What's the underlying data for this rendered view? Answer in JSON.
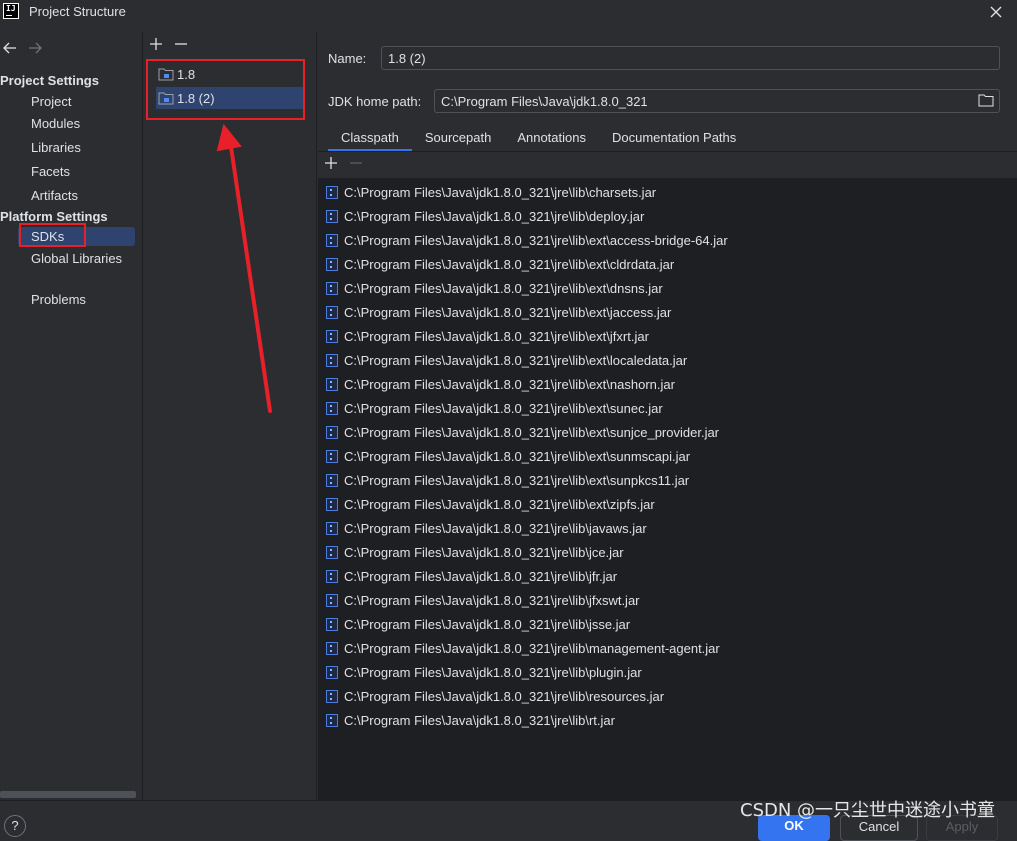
{
  "window": {
    "title": "Project Structure",
    "app_icon_text": "IJ"
  },
  "nav": {
    "sections": [
      {
        "title": "Project Settings",
        "items": [
          "Project",
          "Modules",
          "Libraries",
          "Facets",
          "Artifacts"
        ]
      },
      {
        "title": "Platform Settings",
        "items": [
          "SDKs",
          "Global Libraries"
        ]
      }
    ],
    "extra_items": [
      "Problems"
    ],
    "selected": "SDKs"
  },
  "sdk_list": {
    "items": [
      "1.8",
      "1.8 (2)"
    ],
    "selected_index": 1
  },
  "detail": {
    "name_label": "Name:",
    "name_value": "1.8 (2)",
    "jdk_home_label": "JDK home path:",
    "jdk_home_value": "C:\\Program Files\\Java\\jdk1.8.0_321",
    "tabs": [
      "Classpath",
      "Sourcepath",
      "Annotations",
      "Documentation Paths"
    ],
    "active_tab": "Classpath",
    "classpath": [
      "C:\\Program Files\\Java\\jdk1.8.0_321\\jre\\lib\\charsets.jar",
      "C:\\Program Files\\Java\\jdk1.8.0_321\\jre\\lib\\deploy.jar",
      "C:\\Program Files\\Java\\jdk1.8.0_321\\jre\\lib\\ext\\access-bridge-64.jar",
      "C:\\Program Files\\Java\\jdk1.8.0_321\\jre\\lib\\ext\\cldrdata.jar",
      "C:\\Program Files\\Java\\jdk1.8.0_321\\jre\\lib\\ext\\dnsns.jar",
      "C:\\Program Files\\Java\\jdk1.8.0_321\\jre\\lib\\ext\\jaccess.jar",
      "C:\\Program Files\\Java\\jdk1.8.0_321\\jre\\lib\\ext\\jfxrt.jar",
      "C:\\Program Files\\Java\\jdk1.8.0_321\\jre\\lib\\ext\\localedata.jar",
      "C:\\Program Files\\Java\\jdk1.8.0_321\\jre\\lib\\ext\\nashorn.jar",
      "C:\\Program Files\\Java\\jdk1.8.0_321\\jre\\lib\\ext\\sunec.jar",
      "C:\\Program Files\\Java\\jdk1.8.0_321\\jre\\lib\\ext\\sunjce_provider.jar",
      "C:\\Program Files\\Java\\jdk1.8.0_321\\jre\\lib\\ext\\sunmscapi.jar",
      "C:\\Program Files\\Java\\jdk1.8.0_321\\jre\\lib\\ext\\sunpkcs11.jar",
      "C:\\Program Files\\Java\\jdk1.8.0_321\\jre\\lib\\ext\\zipfs.jar",
      "C:\\Program Files\\Java\\jdk1.8.0_321\\jre\\lib\\javaws.jar",
      "C:\\Program Files\\Java\\jdk1.8.0_321\\jre\\lib\\jce.jar",
      "C:\\Program Files\\Java\\jdk1.8.0_321\\jre\\lib\\jfr.jar",
      "C:\\Program Files\\Java\\jdk1.8.0_321\\jre\\lib\\jfxswt.jar",
      "C:\\Program Files\\Java\\jdk1.8.0_321\\jre\\lib\\jsse.jar",
      "C:\\Program Files\\Java\\jdk1.8.0_321\\jre\\lib\\management-agent.jar",
      "C:\\Program Files\\Java\\jdk1.8.0_321\\jre\\lib\\plugin.jar",
      "C:\\Program Files\\Java\\jdk1.8.0_321\\jre\\lib\\resources.jar",
      "C:\\Program Files\\Java\\jdk1.8.0_321\\jre\\lib\\rt.jar"
    ]
  },
  "buttons": {
    "help": "?",
    "ok": "OK",
    "cancel": "Cancel",
    "apply": "Apply"
  },
  "watermark": "CSDN @一只尘世中迷途小书童",
  "colors": {
    "background": "#2b2d30",
    "list_background": "#1e1f22",
    "selection": "#2e436e",
    "accent": "#3574f0",
    "annotation_red": "#e8202a"
  }
}
